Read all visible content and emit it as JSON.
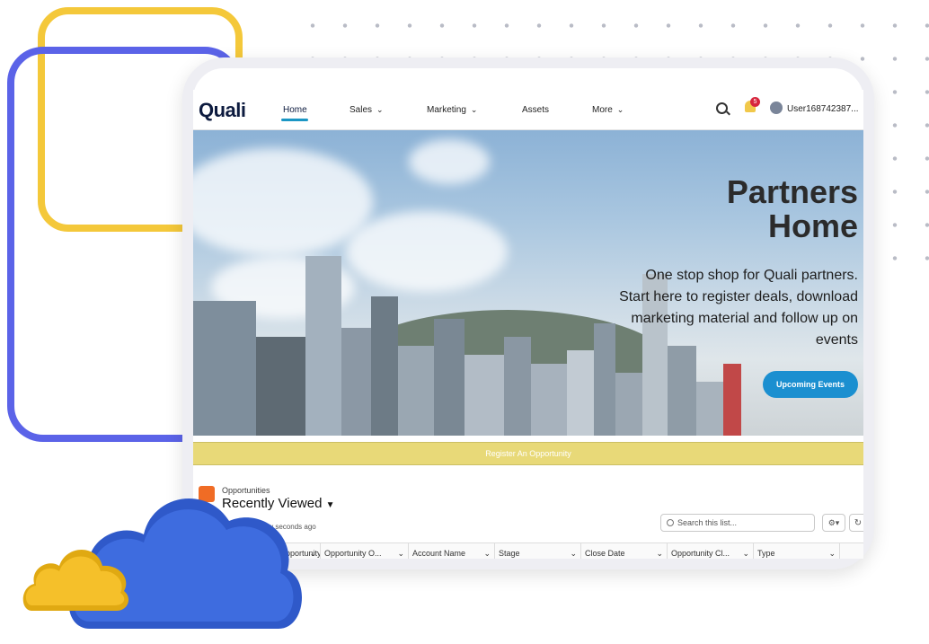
{
  "nav": {
    "logo": "Quali",
    "items": [
      {
        "label": "Home",
        "active": true
      },
      {
        "label": "Sales",
        "has_dropdown": true
      },
      {
        "label": "Marketing",
        "has_dropdown": true
      },
      {
        "label": "Assets"
      },
      {
        "label": "More",
        "has_dropdown": true
      }
    ],
    "notification_count": "5",
    "username": "User168742387..."
  },
  "hero": {
    "title_line1": "Partners",
    "title_line2": "Home",
    "text_line1": "One stop shop for Quali partners.",
    "text_line2": "Start here to register deals, download",
    "text_line3": "marketing material and follow up on",
    "text_line4": "events",
    "button_label": "Upcoming Events"
  },
  "register": {
    "label": "Register An Opportunity"
  },
  "opportunities": {
    "object_label": "Opportunities",
    "list_title": "Recently Viewed",
    "updated_text": "a few seconds ago",
    "search_placeholder": "Search this list...",
    "columns": [
      "Opportunity Na...",
      "Opportunity O...",
      "Account Name",
      "Stage",
      "Close Date",
      "Opportunity Cl...",
      "Type"
    ]
  },
  "colors": {
    "accent": "#1b96c4",
    "button": "#1b8fd0",
    "register_bar": "#e8d978",
    "deco_yellow": "#f4c83a",
    "deco_blue": "#5b63e8"
  }
}
